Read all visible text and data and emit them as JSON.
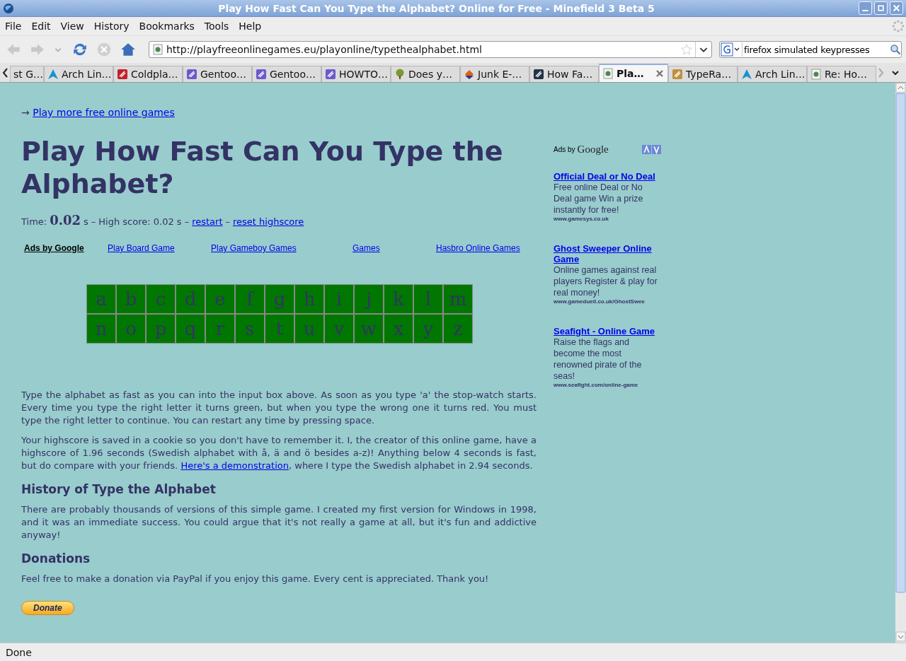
{
  "window": {
    "title": "Play How Fast Can You Type the Alphabet? Online for Free - Minefield 3 Beta 5"
  },
  "menu": [
    "File",
    "Edit",
    "View",
    "History",
    "Bookmarks",
    "Tools",
    "Help"
  ],
  "address": {
    "value": "http://playfreeonlinegames.eu/playonline/typethealphabet.html"
  },
  "search": {
    "value": "firefox simulated keypresses"
  },
  "tabs": [
    {
      "label": "st G…",
      "selected": false,
      "kind": "none"
    },
    {
      "label": "Arch Lin…",
      "selected": false,
      "kind": "arch"
    },
    {
      "label": "Coldpla…",
      "selected": false,
      "kind": "viva"
    },
    {
      "label": "Gentoo…",
      "selected": false,
      "kind": "gentoo"
    },
    {
      "label": "Gentoo…",
      "selected": false,
      "kind": "gentoo"
    },
    {
      "label": "HOWTO…",
      "selected": false,
      "kind": "gentoo"
    },
    {
      "label": "Does y…",
      "selected": false,
      "kind": "tree"
    },
    {
      "label": "Junk E-…",
      "selected": false,
      "kind": "junk"
    },
    {
      "label": "How Fa…",
      "selected": false,
      "kind": "dark"
    },
    {
      "label": "Pla…",
      "selected": true,
      "kind": "page"
    },
    {
      "label": "TypeRa…",
      "selected": false,
      "kind": "wall"
    },
    {
      "label": "Arch Lin…",
      "selected": false,
      "kind": "arch"
    },
    {
      "label": "Re: Ho…",
      "selected": false,
      "kind": "page"
    }
  ],
  "page": {
    "more_link": "Play more free online games",
    "arrow": "→",
    "heading": "Play How Fast Can You Type the Alphabet?",
    "score": {
      "time_label": "Time:",
      "time": "0.02",
      "unit": "s",
      "sep1": "–",
      "high_label": "High score: 0.02 s",
      "sep2": "–",
      "restart": "restart",
      "sep3": "–",
      "reset": "reset highscore"
    },
    "link_ads": {
      "label": "Ads by Google",
      "links": [
        "Play Board Game",
        "Play Gameboy Games",
        "Games",
        "Hasbro Online Games"
      ]
    },
    "letters": [
      "a",
      "b",
      "c",
      "d",
      "e",
      "f",
      "g",
      "h",
      "i",
      "j",
      "k",
      "l",
      "m",
      "n",
      "o",
      "p",
      "q",
      "r",
      "s",
      "t",
      "u",
      "v",
      "w",
      "x",
      "y",
      "z"
    ],
    "intro": "Type the alphabet as fast as you can into the input box above. As soon as you type 'a' the stop-watch starts. Every time you type the right letter it turns green, but when you type the wrong one it turns red. You must type the right letter to continue. You can restart any time by pressing space.",
    "highscore_text": {
      "before": "Your highscore is saved in a cookie so you don't have to remember it. I, the creator of this online game, have a highscore of 1.96 seconds (Swedish alphabet with å, ä and ö besides a-z)! Anything below 4 seconds is fast, but do compare with your friends.",
      "link": "Here's a demonstration",
      "after": ", where I type the Swedish alphabet in 2.94 seconds."
    },
    "history_heading": "History of Type the Alphabet",
    "history_text": "There are probably thousands of versions of this simple game. I created my first version for Windows in 1998, and it was an immediate success. You could argue that it's not really a game at all, but it's fun and addictive anyway!",
    "donations_heading": "Donations",
    "donations_text": "Feel free to make a donation via PayPal if you enjoy this game. Every cent is appreciated. Thank you!",
    "donate_button": "Donate"
  },
  "side_ads": {
    "label": "Ads by",
    "brand": "Google",
    "ads": [
      {
        "title": "Official Deal or No Deal",
        "text": "Free online Deal or No Deal game Win a prize instantly for free!",
        "url": "www.gamesys.co.uk"
      },
      {
        "title": "Ghost Sweeper Online Game",
        "text": "Online games against real players Register & play for real money!",
        "url": "www.gameduell.co.uk/GhostSwee"
      },
      {
        "title": "Seafight - Online Game",
        "text": "Raise the flags and become the most renowned pirate of the seas!",
        "url": "www.seafight.com/online-game"
      }
    ]
  },
  "status_bar": "Done"
}
